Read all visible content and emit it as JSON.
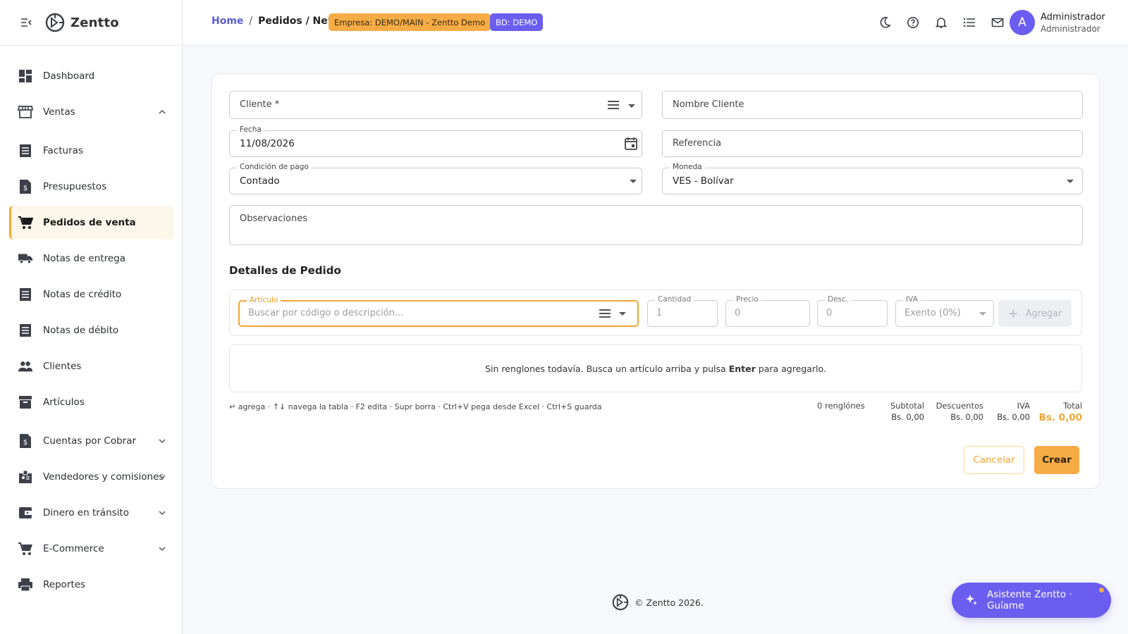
{
  "brand": {
    "name": "Zentto",
    "menu_icon": "menu-collapse-icon",
    "logo_icon": "zentto-logo-icon"
  },
  "sidebar": {
    "items": [
      {
        "label": "Dashboard",
        "icon": "dashboard-icon"
      },
      {
        "label": "Ventas",
        "icon": "store-icon",
        "chevron": "up"
      },
      {
        "label": "Facturas",
        "icon": "receipt-list-icon"
      },
      {
        "label": "Presupuestos",
        "icon": "dollar-document-icon"
      },
      {
        "label": "Pedidos de venta",
        "icon": "cart-icon",
        "active": true
      },
      {
        "label": "Notas de entrega",
        "icon": "truck-icon"
      },
      {
        "label": "Notas de crédito",
        "icon": "receipt-list-icon"
      },
      {
        "label": "Notas de débito",
        "icon": "receipt-list-icon"
      },
      {
        "label": "Clientes",
        "icon": "people-icon"
      },
      {
        "label": "Artículos",
        "icon": "archive-icon"
      },
      {
        "label": "Cuentas por Cobrar",
        "icon": "dollar-document-icon",
        "chevron": "down"
      },
      {
        "label": "Vendedores y comisiones",
        "icon": "badge-icon",
        "chevron": "down"
      },
      {
        "label": "Dinero en tránsito",
        "icon": "wallet-icon",
        "chevron": "down"
      },
      {
        "label": "E-Commerce",
        "icon": "cart-icon",
        "chevron": "down"
      },
      {
        "label": "Reportes",
        "icon": "printer-icon"
      }
    ]
  },
  "header": {
    "breadcrumb": {
      "home": "Home",
      "sep": "/",
      "current": "Pedidos / New"
    },
    "empresa_chip": "Empresa: DEMO/MAIN - Zentto Demo",
    "bd_chip": "BD: DEMO",
    "icons": [
      "moon-icon",
      "help-icon",
      "bell-icon",
      "list-icon",
      "mail-icon"
    ],
    "user": {
      "initial": "A",
      "name": "Administrador",
      "role": "Administrador"
    }
  },
  "form": {
    "cliente_placeholder": "Cliente *",
    "nombre_cliente_placeholder": "Nombre Cliente",
    "fecha_label": "Fecha",
    "fecha_value": "11/08/2026",
    "referencia_placeholder": "Referencia",
    "condicion_label": "Condición de pago",
    "condicion_value": "Contado",
    "moneda_label": "Moneda",
    "moneda_value": "VES - Bolívar",
    "observaciones_placeholder": "Observaciones"
  },
  "detalles": {
    "title": "Detalles de Pedido",
    "articulo_label": "Artículo",
    "articulo_placeholder": "Buscar por código o descripción...",
    "cantidad_label": "Cantidad",
    "cantidad_value": "1",
    "precio_label": "Precio",
    "precio_value": "0",
    "desc_label": "Desc.",
    "desc_value": "0",
    "iva_label": "IVA",
    "iva_value": "Exento (0%)",
    "add_button": "Agregar",
    "empty_pre": "Sin renglones todavía. Busca un artículo arriba y pulsa",
    "empty_key": "Enter",
    "empty_post": "para agregarlo.",
    "shortcuts": "↵ agrega · ↑↓ navega la tabla · F2 edita · Supr borra · Ctrl+V pega desde Excel · Ctrl+S guarda"
  },
  "totals": {
    "renglones": "0 renglónes",
    "subtotal_label": "Subtotal",
    "subtotal_value": "Bs. 0,00",
    "descuentos_label": "Descuentos",
    "descuentos_value": "Bs. 0,00",
    "iva_label": "IVA",
    "iva_value": "Bs. 0,00",
    "total_label": "Total",
    "total_value": "Bs. 0,00"
  },
  "actions": {
    "cancel": "Cancelar",
    "create": "Crear"
  },
  "footer": {
    "text": "© Zentto 2026."
  },
  "assistant": {
    "label": "Asistente Zentto · Guíame",
    "icon": "sparkle-icon"
  },
  "colors": {
    "accent": "#f6ac45",
    "primary": "#6a5df0",
    "link": "#5b5bd6"
  }
}
